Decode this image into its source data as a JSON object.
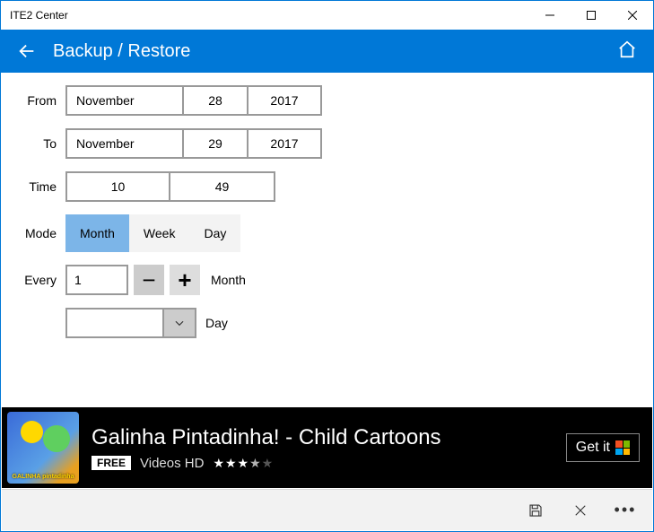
{
  "window": {
    "title": "ITE2 Center"
  },
  "header": {
    "title": "Backup / Restore"
  },
  "form": {
    "from_label": "From",
    "to_label": "To",
    "time_label": "Time",
    "mode_label": "Mode",
    "every_label": "Every",
    "from": {
      "month": "November",
      "day": "28",
      "year": "2017"
    },
    "to": {
      "month": "November",
      "day": "29",
      "year": "2017"
    },
    "time": {
      "hour": "10",
      "minute": "49"
    },
    "modes": {
      "month": "Month",
      "week": "Week",
      "day": "Day",
      "active": "month"
    },
    "every": {
      "value": "1",
      "minus": "−",
      "plus": "+",
      "unit": "Month"
    },
    "day_selector": {
      "value": "",
      "unit": "Day"
    }
  },
  "ad": {
    "title": "Galinha Pintadinha! - Child Cartoons",
    "badge": "FREE",
    "subtitle": "Videos HD",
    "stars_full": "★★★",
    "stars_half": "★",
    "stars_empty": "★",
    "cta": "Get it",
    "thumb_text": "GALINHA pintadinha"
  }
}
